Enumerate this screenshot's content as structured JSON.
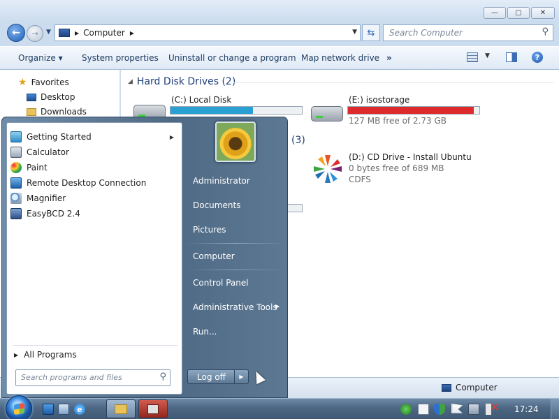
{
  "explorer": {
    "address": {
      "path": "Computer"
    },
    "search_placeholder": "Search Computer",
    "toolbar": {
      "organize": "Organize",
      "system_properties": "System properties",
      "uninstall": "Uninstall or change a program",
      "map_drive": "Map network drive",
      "more": "»"
    },
    "navpane": {
      "favorites": "Favorites",
      "desktop": "Desktop",
      "downloads": "Downloads"
    },
    "sections": {
      "hard_disks": "Hard Disk Drives (2)",
      "removable_count": "(3)"
    },
    "drives": {
      "c": {
        "name": "(C:) Local Disk",
        "used_fraction": 0.63,
        "bar_color": "#2a9fd2"
      },
      "e": {
        "name": "(E:) isostorage",
        "used_fraction": 0.96,
        "bar_color": "#de2a2a",
        "free": "127 MB free of 2.73 GB"
      },
      "d": {
        "name": "(D:) CD Drive - Install Ubuntu",
        "free": "0 bytes free of 689 MB",
        "fs": "CDFS"
      }
    },
    "status": {
      "computer": "Computer"
    }
  },
  "startmenu": {
    "programs": [
      {
        "label": "Getting Started",
        "icon": "getting-started-icon",
        "has_submenu": true
      },
      {
        "label": "Calculator",
        "icon": "calculator-icon"
      },
      {
        "label": "Paint",
        "icon": "paint-icon"
      },
      {
        "label": "Remote Desktop Connection",
        "icon": "remote-desktop-icon"
      },
      {
        "label": "Magnifier",
        "icon": "magnifier-icon"
      },
      {
        "label": "EasyBCD 2.4",
        "icon": "easybcd-icon"
      }
    ],
    "all_programs": "All Programs",
    "search_placeholder": "Search programs and files",
    "right": {
      "user": "Administrator",
      "documents": "Documents",
      "pictures": "Pictures",
      "computer": "Computer",
      "control_panel": "Control Panel",
      "admin_tools": "Administrative Tools",
      "run": "Run..."
    },
    "logoff": "Log off"
  },
  "taskbar": {
    "clock": "17:24"
  }
}
